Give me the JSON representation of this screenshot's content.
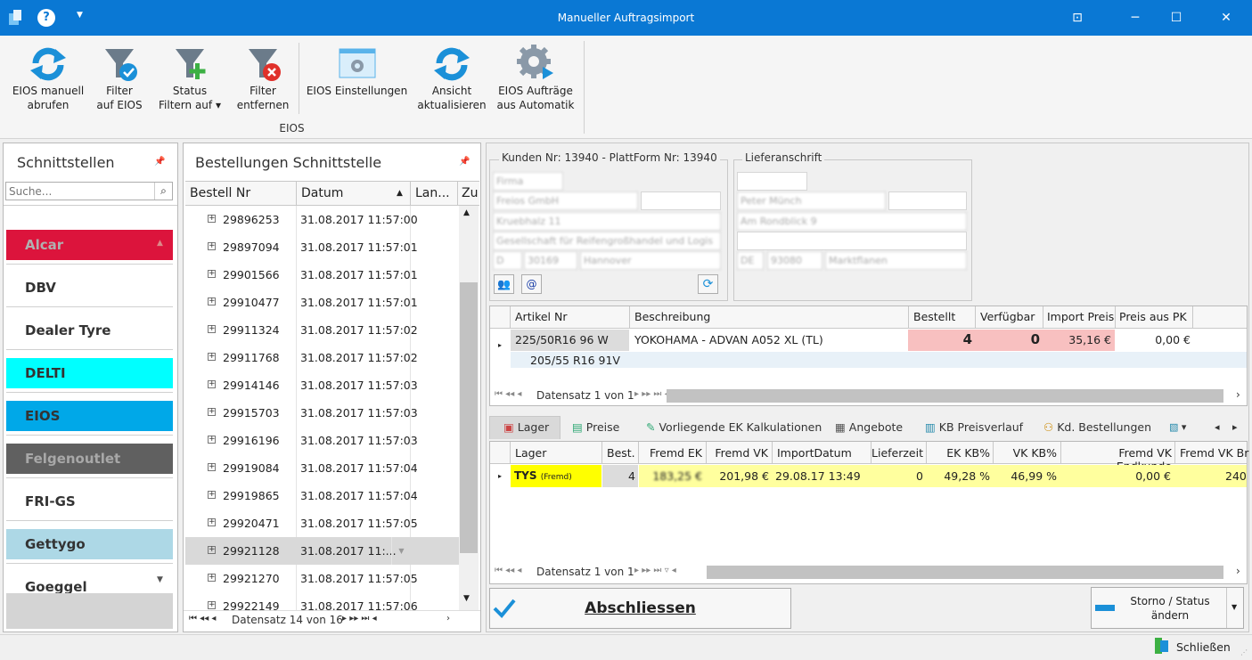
{
  "window": {
    "title": "Manueller Auftragsimport"
  },
  "ribbon": {
    "buttons": [
      {
        "id": "eios_abrufen",
        "label": "EIOS manuell\nabrufen"
      },
      {
        "id": "filter_eios",
        "label": "Filter\nauf EIOS"
      },
      {
        "id": "status_filter",
        "label": "Status\nFiltern auf ▾"
      },
      {
        "id": "filter_entfernen",
        "label": "Filter\nentfernen"
      },
      {
        "id": "eios_einstellungen",
        "label": "EIOS Einstellungen"
      },
      {
        "id": "ansicht",
        "label": "Ansicht\naktualisieren"
      },
      {
        "id": "eios_automatik",
        "label": "EIOS Aufträge\naus Automatik"
      }
    ],
    "group_label": "EIOS"
  },
  "interfaces": {
    "title": "Schnittstellen",
    "search_placeholder": "Suche...",
    "items": [
      {
        "label": "Alcar",
        "bg": "#dc143c",
        "fg": "#b0b0b0"
      },
      {
        "label": "DBV",
        "bg": "#ffffff",
        "fg": "#333333"
      },
      {
        "label": "Dealer Tyre",
        "bg": "#ffffff",
        "fg": "#333333"
      },
      {
        "label": "DELTI",
        "bg": "#00ffff",
        "fg": "#333333"
      },
      {
        "label": "EIOS",
        "bg": "#00a8e8",
        "fg": "#333333"
      },
      {
        "label": "Felgenoutlet",
        "bg": "#606060",
        "fg": "#a8a8a8"
      },
      {
        "label": "FRI-GS",
        "bg": "#ffffff",
        "fg": "#333333"
      },
      {
        "label": "Gettygo",
        "bg": "#add8e6",
        "fg": "#333333"
      },
      {
        "label": "Goeggel",
        "bg": "#ffffff",
        "fg": "#333333"
      }
    ]
  },
  "orders": {
    "title": "Bestellungen Schnittstelle",
    "columns": [
      "Bestell Nr",
      "Datum",
      "Lan...",
      "Zu"
    ],
    "rows": [
      {
        "nr": "29896253",
        "datum": "31.08.2017 11:57:00"
      },
      {
        "nr": "29897094",
        "datum": "31.08.2017 11:57:01"
      },
      {
        "nr": "29901566",
        "datum": "31.08.2017 11:57:01"
      },
      {
        "nr": "29910477",
        "datum": "31.08.2017 11:57:01"
      },
      {
        "nr": "29911324",
        "datum": "31.08.2017 11:57:02"
      },
      {
        "nr": "29911768",
        "datum": "31.08.2017 11:57:02"
      },
      {
        "nr": "29914146",
        "datum": "31.08.2017 11:57:03"
      },
      {
        "nr": "29915703",
        "datum": "31.08.2017 11:57:03"
      },
      {
        "nr": "29916196",
        "datum": "31.08.2017 11:57:03"
      },
      {
        "nr": "29919084",
        "datum": "31.08.2017 11:57:04"
      },
      {
        "nr": "29919865",
        "datum": "31.08.2017 11:57:04"
      },
      {
        "nr": "29920471",
        "datum": "31.08.2017 11:57:05"
      },
      {
        "nr": "29921128",
        "datum": "31.08.2017 11:..."
      },
      {
        "nr": "29921270",
        "datum": "31.08.2017 11:57:05"
      },
      {
        "nr": "29922149",
        "datum": "31.08.2017 11:57:06"
      }
    ],
    "selected_index": 12,
    "nav": "Datensatz 14 von 16"
  },
  "customer": {
    "title": "Kunden Nr: 13940 - PlattForm Nr: 13940",
    "fields": [
      "Firma",
      "Freios GmbH",
      "",
      "Kruebhalz 11",
      "Gesellschaft für Reifengroßhandel und Logis",
      "D",
      "30169",
      "Hannover"
    ]
  },
  "delivery": {
    "title": "Lieferanschrift",
    "fields": [
      "",
      "Peter Münch",
      "",
      "Am Rondblick 9",
      "",
      "DE",
      "93080",
      "Marktflanen"
    ]
  },
  "articles": {
    "columns": [
      "Artikel Nr",
      "Beschreibung",
      "Bestellt",
      "Verfügbar",
      "Import Preis",
      "Preis aus PK"
    ],
    "row": {
      "artikel": "225/50R16 96 W",
      "beschreibung": "YOKOHAMA - ADVAN A052 XL (TL)",
      "bestellt": "4",
      "verfuegbar": "0",
      "import_preis": "35,16 €",
      "preis_pk": "0,00 €"
    },
    "subrow": "205/55 R16 91V",
    "nav": "Datensatz 1 von 1"
  },
  "tabs": [
    "Lager",
    "Preise",
    "Vorliegende EK Kalkulationen",
    "Angebote",
    "KB Preisverlauf",
    "Kd. Bestellungen"
  ],
  "stock": {
    "columns": [
      "Lager",
      "Best.",
      "Fremd EK",
      "Fremd VK",
      "ImportDatum",
      "Lieferzeit",
      "EK KB%",
      "VK KB%",
      "Fremd VK Endkunde",
      "Fremd VK Br"
    ],
    "row": {
      "lager": "TYS",
      "lager_sub": "(Fremd)",
      "best": "4",
      "fremd_ek": "183,25 €",
      "fremd_vk": "201,98 €",
      "datum": "29.08.17 13:49",
      "lieferzeit": "0",
      "ek_kb": "49,28 %",
      "vk_kb": "46,99 %",
      "endkunde": "0,00 €",
      "br": "240"
    },
    "nav": "Datensatz 1 von 1"
  },
  "actions": {
    "finish": "Abschliessen",
    "storno": "Storno / Status\nändern"
  },
  "status": {
    "close": "Schließen"
  },
  "colors": {
    "titlebar": "#0a78d4",
    "accent": "#1e90d8",
    "pink": "#f8c0c0",
    "yellow": "#ffff9e"
  }
}
